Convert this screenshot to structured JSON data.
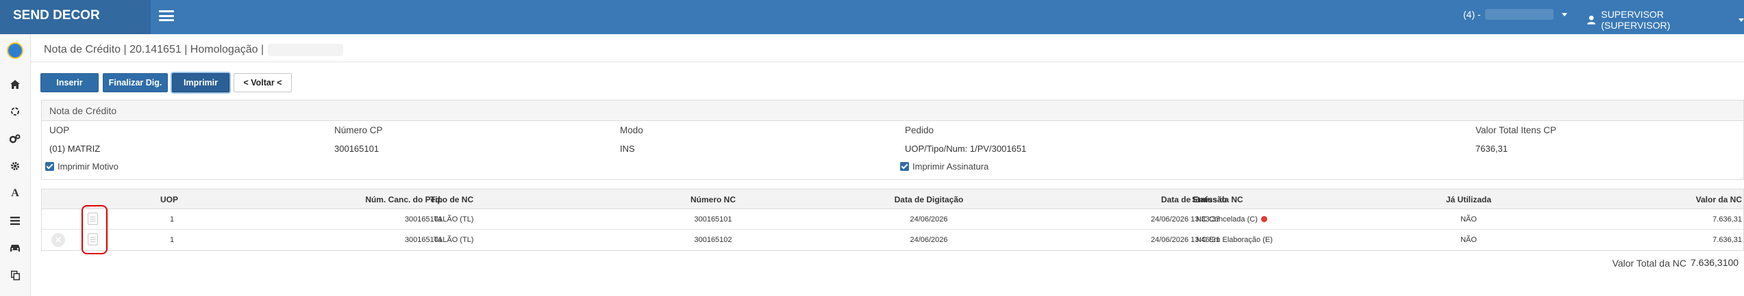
{
  "header": {
    "brand": "SEND DECOR",
    "org_selector": "(4) -",
    "user": "SUPERVISOR (SUPERVISOR)",
    "accent_color": "#3a79b6"
  },
  "sidebar": {
    "icons": [
      "home-icon",
      "refresh-icon",
      "cogs-icon",
      "gear-icon",
      "font-icon",
      "list-icon",
      "car-icon",
      "copy-icon"
    ]
  },
  "breadcrumb": {
    "text": "Nota de Crédito | 20.141651 | Homologação |"
  },
  "toolbar": {
    "inserir": "Inserir",
    "finalizar": "Finalizar Dig.",
    "imprimir": "Imprimir",
    "voltar": "< Voltar <"
  },
  "panel": {
    "title": "Nota de Crédito",
    "fields": [
      {
        "label": "UOP",
        "value": "(01) MATRIZ"
      },
      {
        "label": "Número CP",
        "value": "300165101"
      },
      {
        "label": "Modo",
        "value": "INS"
      },
      {
        "label": "Pedido",
        "value": "UOP/Tipo/Num: 1/PV/3001651"
      },
      {
        "label": "Valor Total Itens CP",
        "value": "7636,31"
      }
    ],
    "checkboxes": {
      "imprimir_motivo": "Imprimir Motivo",
      "imprimir_assinatura": "Imprimir Assinatura"
    }
  },
  "grid": {
    "columns": {
      "uop": "UOP",
      "num_canc": "Núm. Canc. do Ped.",
      "tipo_nc": "Tipo de NC",
      "numero_nc": "Número NC",
      "data_digitacao": "Data de Digitação",
      "data_emissao": "Data de Emissão",
      "status_nc": "Status da NC",
      "ja_utilizada": "Já Utilizada",
      "valor_nc": "Valor da NC"
    },
    "rows": [
      {
        "uop": "1",
        "num_canc": "300165101",
        "tipo_nc": "TALÃO (TL)",
        "numero_nc": "300165101",
        "data_digitacao": "24/06/2026",
        "data_emissao": "24/06/2026 13:33:37",
        "status_nc": "NC Cancelada (C)",
        "ja_utilizada": "NÃO",
        "valor_nc": "7.636,31"
      },
      {
        "uop": "1",
        "num_canc": "300165101",
        "tipo_nc": "TALÃO (TL)",
        "numero_nc": "300165102",
        "data_digitacao": "24/06/2026",
        "data_emissao": "24/06/2026 13:46:21",
        "status_nc": "NC Em Elaboração (E)",
        "ja_utilizada": "NÃO",
        "valor_nc": "7.636,31"
      }
    ]
  },
  "totals": {
    "label": "Valor Total da NC",
    "value": "7.636,3100"
  }
}
